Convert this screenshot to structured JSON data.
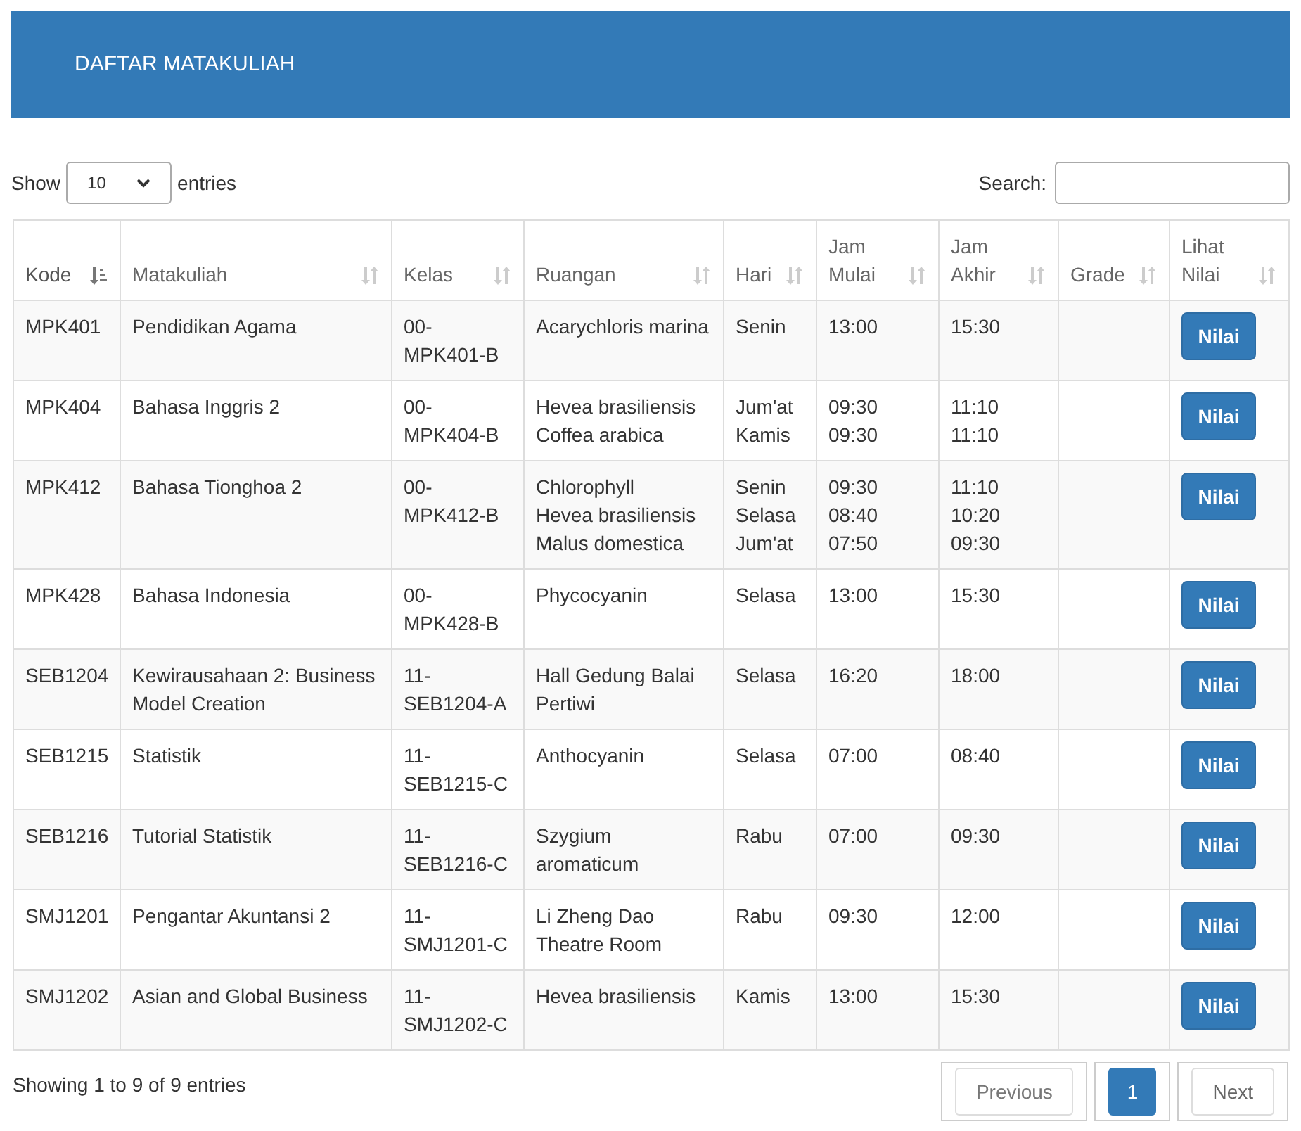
{
  "header": {
    "title": "DAFTAR MATAKULIAH"
  },
  "length": {
    "label_before": "Show",
    "value": "10",
    "label_after": "entries"
  },
  "search": {
    "label": "Search:"
  },
  "columns": [
    {
      "label": "Kode",
      "sorted": true
    },
    {
      "label": "Matakuliah",
      "sorted": false
    },
    {
      "label": "Kelas",
      "sorted": false
    },
    {
      "label": "Ruangan",
      "sorted": false
    },
    {
      "label": "Hari",
      "sorted": false
    },
    {
      "label": "Jam Mulai",
      "sorted": false
    },
    {
      "label": "Jam Akhir",
      "sorted": false
    },
    {
      "label": "Grade",
      "sorted": false
    },
    {
      "label": "Lihat Nilai",
      "sorted": false
    }
  ],
  "rows": [
    {
      "kode": "MPK401",
      "matakuliah": "Pendidikan Agama",
      "kelas": "00-MPK401-B",
      "ruangan": [
        "Acarychloris marina"
      ],
      "hari": [
        "Senin"
      ],
      "mulai": [
        "13:00"
      ],
      "akhir": [
        "15:30"
      ],
      "button": "Nilai"
    },
    {
      "kode": "MPK404",
      "matakuliah": "Bahasa Inggris 2",
      "kelas": "00-MPK404-B",
      "ruangan": [
        "Hevea brasiliensis",
        "Coffea arabica"
      ],
      "hari": [
        "Jum'at",
        "Kamis"
      ],
      "mulai": [
        "09:30",
        "09:30"
      ],
      "akhir": [
        "11:10",
        "11:10"
      ],
      "button": "Nilai"
    },
    {
      "kode": "MPK412",
      "matakuliah": "Bahasa Tionghoa 2",
      "kelas": "00-MPK412-B",
      "ruangan": [
        "Chlorophyll",
        "Hevea brasiliensis",
        "Malus domestica"
      ],
      "hari": [
        "Senin",
        "Selasa",
        "Jum'at"
      ],
      "mulai": [
        "09:30",
        "08:40",
        "07:50"
      ],
      "akhir": [
        "11:10",
        "10:20",
        "09:30"
      ],
      "button": "Nilai"
    },
    {
      "kode": "MPK428",
      "matakuliah": "Bahasa Indonesia",
      "kelas": "00-MPK428-B",
      "ruangan": [
        "Phycocyanin"
      ],
      "hari": [
        "Selasa"
      ],
      "mulai": [
        "13:00"
      ],
      "akhir": [
        "15:30"
      ],
      "button": "Nilai"
    },
    {
      "kode": "SEB1204",
      "matakuliah": "Kewirausahaan 2: Business Model Creation",
      "kelas": "11-SEB1204-A",
      "ruangan": [
        "Hall Gedung Balai Pertiwi"
      ],
      "hari": [
        "Selasa"
      ],
      "mulai": [
        "16:20"
      ],
      "akhir": [
        "18:00"
      ],
      "button": "Nilai"
    },
    {
      "kode": "SEB1215",
      "matakuliah": "Statistik",
      "kelas": "11-SEB1215-C",
      "ruangan": [
        "Anthocyanin"
      ],
      "hari": [
        "Selasa"
      ],
      "mulai": [
        "07:00"
      ],
      "akhir": [
        "08:40"
      ],
      "button": "Nilai"
    },
    {
      "kode": "SEB1216",
      "matakuliah": "Tutorial Statistik",
      "kelas": "11-SEB1216-C",
      "ruangan": [
        "Szygium aromaticum"
      ],
      "hari": [
        "Rabu"
      ],
      "mulai": [
        "07:00"
      ],
      "akhir": [
        "09:30"
      ],
      "button": "Nilai"
    },
    {
      "kode": "SMJ1201",
      "matakuliah": "Pengantar Akuntansi 2",
      "kelas": "11-SMJ1201-C",
      "ruangan": [
        "Li Zheng Dao Theatre Room"
      ],
      "hari": [
        "Rabu"
      ],
      "mulai": [
        "09:30"
      ],
      "akhir": [
        "12:00"
      ],
      "button": "Nilai"
    },
    {
      "kode": "SMJ1202",
      "matakuliah": "Asian and Global Business",
      "kelas": "11-SMJ1202-C",
      "ruangan": [
        "Hevea brasiliensis"
      ],
      "hari": [
        "Kamis"
      ],
      "mulai": [
        "13:00"
      ],
      "akhir": [
        "15:30"
      ],
      "button": "Nilai"
    }
  ],
  "info": "Showing 1 to 9 of 9 entries",
  "pagination": [
    {
      "label": "Previous",
      "kind": "nav",
      "disabled": true,
      "selected": false
    },
    {
      "label": "1",
      "kind": "page",
      "disabled": false,
      "selected": true
    },
    {
      "label": "Next",
      "kind": "nav",
      "disabled": false,
      "selected": false
    }
  ]
}
